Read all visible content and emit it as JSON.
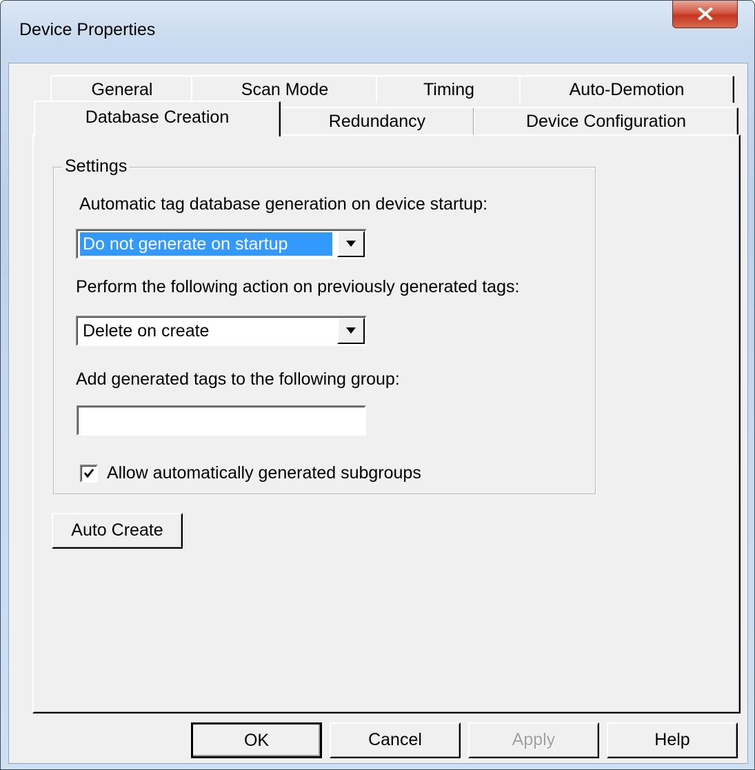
{
  "window": {
    "title": "Device Properties"
  },
  "tabs": {
    "row_back": [
      "General",
      "Scan Mode",
      "Timing",
      "Auto-Demotion"
    ],
    "row_front": [
      "Database Creation",
      "Redundancy",
      "Device Configuration"
    ],
    "selected": "Database Creation"
  },
  "settings": {
    "group_title": "Settings",
    "startup_label": "Automatic tag database generation on device startup:",
    "startup_value": "Do not generate on startup",
    "action_label": "Perform the following action on previously generated tags:",
    "action_value": "Delete on create",
    "group_label": "Add generated tags to the following group:",
    "group_value": "",
    "subgroups_label": "Allow automatically generated subgroups",
    "subgroups_checked": true
  },
  "auto_create_label": "Auto Create",
  "buttons": {
    "ok": "OK",
    "cancel": "Cancel",
    "apply": "Apply",
    "help": "Help"
  },
  "colors": {
    "selection": "#3399ff",
    "close_button": "#c4361f"
  }
}
